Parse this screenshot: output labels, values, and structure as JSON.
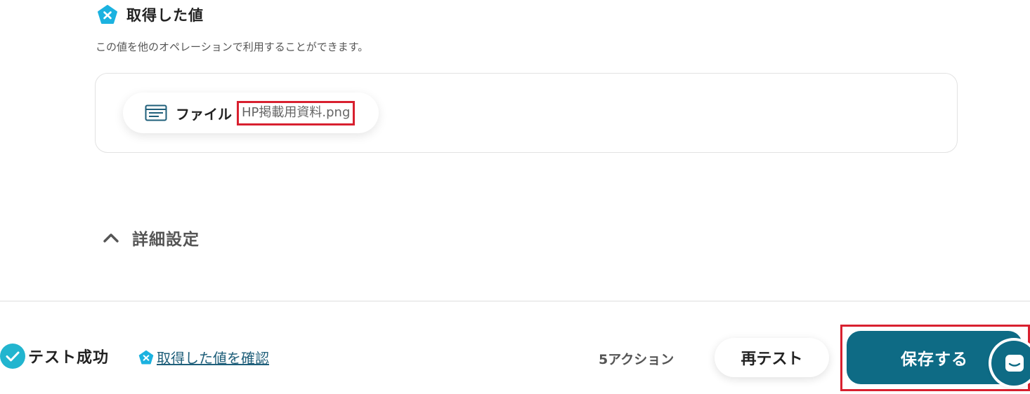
{
  "section": {
    "title": "取得した値",
    "description": "この値を他のオペレーションで利用することができます。"
  },
  "output_field": {
    "label": "ファイル",
    "value": "HP掲載用資料.png"
  },
  "advanced": {
    "label": "詳細設定"
  },
  "footer": {
    "status_label": "テスト成功",
    "view_values_link": "取得した値を確認",
    "action_count": "5アクション",
    "retest_label": "再テスト",
    "save_label": "保存する"
  },
  "colors": {
    "accent": "#0e6b85",
    "pentagon": "#1bb2e0",
    "check": "#22b5cf",
    "highlight": "#d8202f"
  },
  "icons": [
    "pentagon-x-icon",
    "file-window-icon",
    "chevron-up-icon",
    "check-circle-icon",
    "chat-icon"
  ]
}
